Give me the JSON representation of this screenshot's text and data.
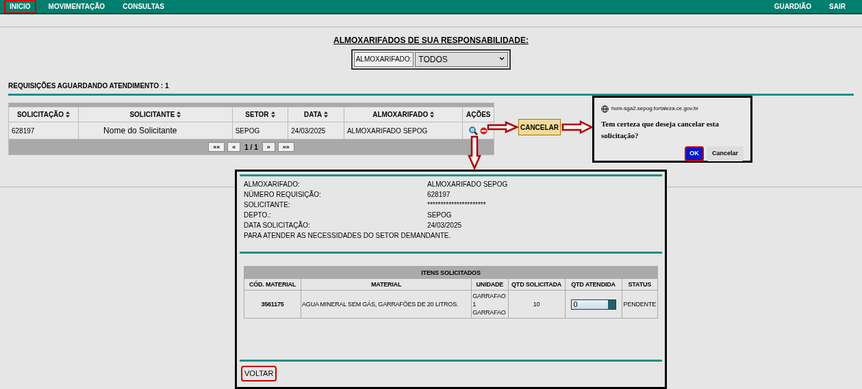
{
  "nav": {
    "items": [
      {
        "label": "INICIO",
        "highlighted": true
      },
      {
        "label": "MOVIMENTAÇÃO",
        "highlighted": false
      },
      {
        "label": "CONSULTAS",
        "highlighted": false
      }
    ],
    "right_items": [
      {
        "label": "GUARDIÃO"
      },
      {
        "label": "SAIR"
      }
    ]
  },
  "responsibility": {
    "title": "ALMOXARIFADOS DE SUA RESPONSABILIDADE:",
    "select_label": "ALMOXARIFADO:",
    "select_value": "TODOS"
  },
  "requests_heading": "REQUISIÇÕES AGUARDANDO ATENDIMENTO : 1",
  "table": {
    "columns": [
      {
        "label": "SOLICITAÇÃO",
        "sortable": true
      },
      {
        "label": "SOLICITANTE",
        "sortable": true
      },
      {
        "label": "SETOR",
        "sortable": true
      },
      {
        "label": "DATA",
        "sortable": true
      },
      {
        "label": "ALMOXARIFADO",
        "sortable": true
      },
      {
        "label": "AÇÕES",
        "sortable": false
      }
    ],
    "rows": [
      {
        "solicitacao": "628197",
        "solicitante": "Nome do Solicitante",
        "setor": "SEPOG",
        "data": "24/03/2025",
        "almoxarifado": "ALMOXARIFADO SEPOG"
      }
    ],
    "pager": {
      "first": "««",
      "prev": "«",
      "page": "1 / 1",
      "next": "»",
      "last": "»»"
    }
  },
  "cancel_callout": {
    "label": "CANCELAR"
  },
  "dialog": {
    "origin": "hom-sga2.sepog.fortaleza.ce.gov.br",
    "message": "Tem certeza que deseja cancelar esta solicitação?",
    "ok": {
      "label": "OK",
      "highlighted": true
    },
    "cancel": {
      "label": "Cancelar",
      "highlighted": false
    }
  },
  "detail": {
    "fields": [
      {
        "label": "ALMOXARIFADO:",
        "value": "ALMOXARIFADO SEPOG"
      },
      {
        "label": "NÚMERO REQUISIÇÃO:",
        "value": "628197"
      },
      {
        "label": "SOLICITANTE:",
        "value": "**********************"
      },
      {
        "label": "DEPTO.:",
        "value": "SEPOG"
      },
      {
        "label": "DATA SOLICITAÇÃO:",
        "value": "24/03/2025"
      }
    ],
    "note": "PARA ATENDER AS NECESSIDADES DO SETOR DEMANDANTE.",
    "items_title": "ITENS SOLICITADOS",
    "columns": [
      "CÓD. MATERIAL",
      "MATERIAL",
      "UNIDADE",
      "QTD SOLICITADA",
      "QTD ATENDIDA",
      "STATUS"
    ],
    "rows": [
      {
        "codigo": "3561175",
        "material": "AGUA MINERAL SEM GÁS, GARRAFÕES DE 20 LITROS.",
        "unidade": [
          "GARRAFAO",
          "1",
          "GARRAFAO"
        ],
        "qtd_solicitada": "10",
        "qtd_atendida": "0",
        "status": "PENDENTE"
      }
    ],
    "back": {
      "label": "VOLTAR",
      "highlighted": true
    }
  }
}
